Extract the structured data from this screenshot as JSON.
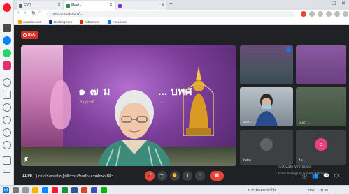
{
  "browser": {
    "tabs": [
      {
        "label": "EVO",
        "favicon_color": "#5f6368"
      },
      {
        "label": "Meet - ...",
        "favicon_color": "#1e8e3e"
      },
      {
        "label": "... ...",
        "favicon_color": "#8430ce"
      }
    ],
    "new_tab": "+",
    "window_controls": {
      "minimize": "—",
      "maximize": "☐",
      "close": "✕"
    },
    "url": "meet.google.com/...",
    "bookmarks": [
      {
        "label": "Amazon.com",
        "color": "#ff9900"
      },
      {
        "label": "Booking.com",
        "color": "#003580"
      },
      {
        "label": "AliExpress",
        "color": "#e62e04"
      },
      {
        "label": "Facebook",
        "color": "#1877f2"
      }
    ]
  },
  "meet": {
    "rec_label": "REC",
    "main_tile": {
      "slide_title_left": "๑ ๗ ม",
      "slide_title_right": "... บพศ",
      "slide_sub_left": "\"บุญบารมี ...",
      "slide_sub_right": "... \""
    },
    "tiles": [
      {
        "name": "",
        "badge": true
      },
      {
        "name": "",
        "badge": false
      },
      {
        "name": "นางสาว ...",
        "badge": false
      },
      {
        "name": "DLICT ...",
        "badge": false
      },
      {
        "name": "จันทิรา ...",
        "avatar": "",
        "avatar_color": "#5f6368"
      },
      {
        "name": "กี ร ...",
        "avatar": "E",
        "avatar_color": "#e8437a"
      }
    ],
    "bottom": {
      "time": "11:08",
      "separator": "|",
      "meeting_title": "การประชุมเชิงปฏิบัติการเสริมสร้างภาพลักษณ์ที่ดีฯ ...",
      "controls": {
        "mic": "🎤",
        "camera": "📷",
        "raise_hand": "✋",
        "present": "⬆",
        "more": "⋮",
        "leave": "☎"
      },
      "right_controls": {
        "info": "ⓘ",
        "people": "👥",
        "chat": "💬",
        "activities": "⬡"
      },
      "activate_title": "Activate Windows",
      "activate_sub": "Go to Settings to activate Windows."
    }
  },
  "taskbar": {
    "start": "⊞",
    "weather": "31°C",
    "weather_desc": "อัพเดทแนวโน้ม...",
    "lang": "ENG",
    "time": "11:08",
    "date": "..."
  },
  "sidebar_icons": [
    {
      "name": "opera-logo",
      "color": "#ff1b2d"
    },
    {
      "name": "workspace-icon",
      "color": "#4a4a4a"
    },
    {
      "name": "messenger-icon",
      "color": "#0084ff"
    },
    {
      "name": "whatsapp-icon",
      "color": "#25d366"
    },
    {
      "name": "instagram-icon",
      "color": "#e1306c"
    }
  ]
}
